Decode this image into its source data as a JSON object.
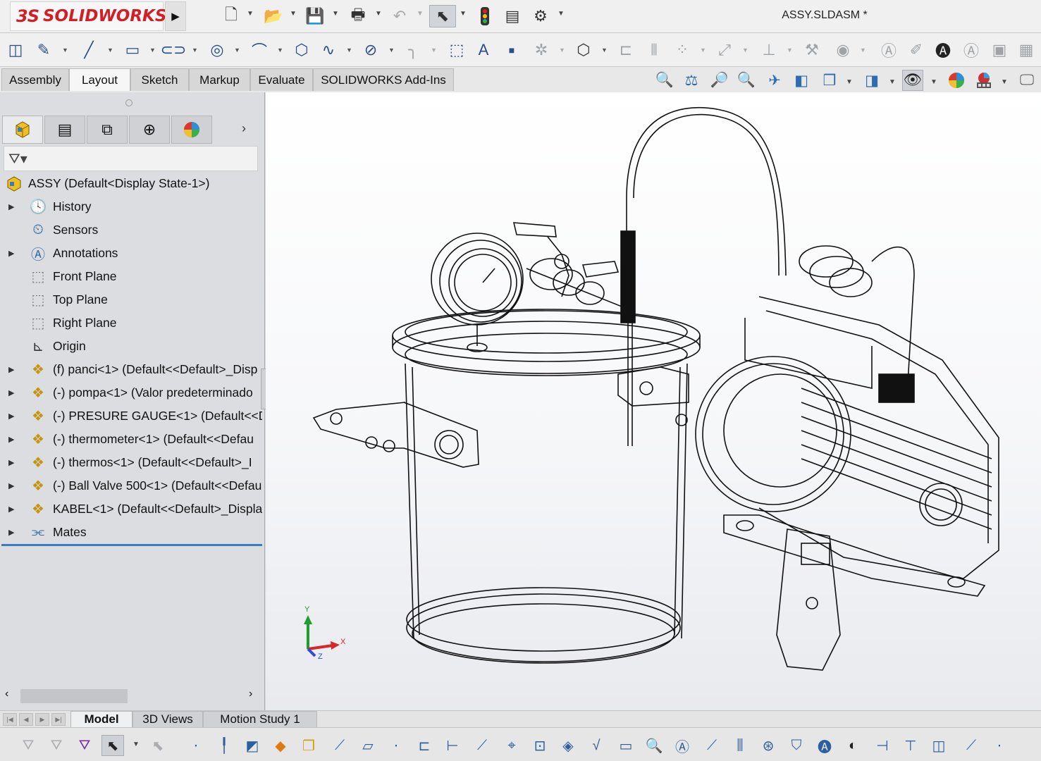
{
  "app": {
    "brand": "SOLIDWORKS",
    "brand_mark": "3S",
    "document_title": "ASSY.SLDASM *"
  },
  "quick_access": {
    "items": [
      "new-document-icon",
      "open-icon",
      "save-icon",
      "print-icon",
      "undo-icon",
      "select-arrow-icon",
      "rebuild-traffic-light-icon",
      "file-properties-icon",
      "options-gear-icon"
    ]
  },
  "command_tabs": [
    {
      "label": "Assembly",
      "active": false
    },
    {
      "label": "Layout",
      "active": true
    },
    {
      "label": "Sketch",
      "active": false
    },
    {
      "label": "Markup",
      "active": false
    },
    {
      "label": "Evaluate",
      "active": false
    },
    {
      "label": "SOLIDWORKS Add-Ins",
      "active": false
    }
  ],
  "feature_tree": {
    "root": "ASSY  (Default<Display State-1>)",
    "items": [
      {
        "label": "History",
        "icon": "history-icon",
        "expandable": true
      },
      {
        "label": "Sensors",
        "icon": "sensors-icon",
        "expandable": false
      },
      {
        "label": "Annotations",
        "icon": "annotations-icon",
        "expandable": true
      },
      {
        "label": "Front Plane",
        "icon": "plane-icon",
        "expandable": false
      },
      {
        "label": "Top Plane",
        "icon": "plane-icon",
        "expandable": false
      },
      {
        "label": "Right Plane",
        "icon": "plane-icon",
        "expandable": false
      },
      {
        "label": "Origin",
        "icon": "origin-icon",
        "expandable": false
      },
      {
        "label": "(f) panci<1> (Default<<Default>_Disp",
        "icon": "part-icon",
        "expandable": true
      },
      {
        "label": "(-) pompa<1> (Valor predeterminado",
        "icon": "part-icon",
        "expandable": true
      },
      {
        "label": "(-) PRESURE GAUGE<1> (Default<<De",
        "icon": "part-icon",
        "expandable": true
      },
      {
        "label": "(-) thermometer<1> (Default<<Defau",
        "icon": "part-icon",
        "expandable": true
      },
      {
        "label": "(-) thermos<1> (Default<<Default>_I",
        "icon": "part-icon",
        "expandable": true
      },
      {
        "label": "(-) Ball Valve 500<1> (Default<<Defau",
        "icon": "part-icon",
        "expandable": true
      },
      {
        "label": "KABEL<1> (Default<<Default>_Displa",
        "icon": "part-icon",
        "expandable": true
      },
      {
        "label": "Mates",
        "icon": "mates-icon",
        "expandable": true
      }
    ]
  },
  "triad": {
    "x": "X",
    "y": "Y",
    "z": "Z"
  },
  "bottom_tabs": [
    {
      "label": "Model",
      "active": true
    },
    {
      "label": "3D Views",
      "active": false
    },
    {
      "label": "Motion Study 1",
      "active": false
    }
  ]
}
